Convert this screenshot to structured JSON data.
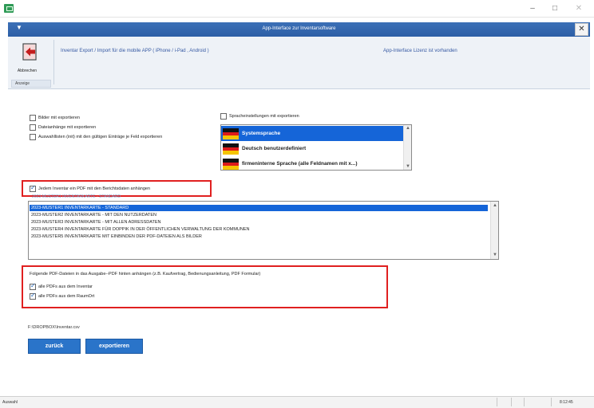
{
  "window": {
    "minimize": "–",
    "maximize": "□",
    "close": "✕"
  },
  "dialog": {
    "menu_icon": "▼",
    "title": "App-Interface zur Inventarsoftware",
    "close": "✕"
  },
  "ribbon": {
    "back_label": "Abbrechen",
    "group_label": "Anzeige",
    "caption": "Inventar Export / Import für die mobile APP ( iPhone / i-Pad , Android )",
    "license": "App-Interface Lizenz ist vorhanden"
  },
  "options": {
    "images": "Bilder mit exportieren",
    "attachments": "Dateianhänge mit exportieren",
    "selection_lists": "Auswahllisten (init) mit den gültigen Einträge je Feld exportieren",
    "language_settings": "Spracheinstellungen mit exportieren"
  },
  "languages": [
    {
      "label": "Systemsprache",
      "selected": true
    },
    {
      "label": "Deutsch benutzerdefiniert",
      "selected": false
    },
    {
      "label": "firmeninterne Sprache (alle Feldnamen mit x...)",
      "selected": false
    }
  ],
  "attach_pdf": {
    "label": "Jedem Inventar ein PDF mit den Berichtsdaten anhängen",
    "checked": true
  },
  "sub_link": "2023-MUSTER1 INVENTARKARTE - STANDARD",
  "reports": [
    {
      "label": "2023-MUSTER1 INVENTARKARTE - STANDARD",
      "selected": true
    },
    {
      "label": "2023-MUSTER2 INVENTARKARTE - MIT DEN NUTZERDATEN",
      "selected": false
    },
    {
      "label": "2023-MUSTER3 INVENTARKARTE - MIT ALLEN ADRESSDATEN",
      "selected": false
    },
    {
      "label": "2023-MUSTER4 INVENTARKARTE FÜR DOPPIK IN DER ÖFFENTLICHEN VERWALTUNG DER KOMMUNEN",
      "selected": false
    },
    {
      "label": "2023-MUSTER5 INVENTARKARTE MIT EINBINDEN DER PDF-DATEIEN ALS BILDER",
      "selected": false
    }
  ],
  "pdf_section": {
    "heading": "Folgende PDF-Dateien in das Ausgabe--PDF hinten anhängen (z.B. Kaufvertrag, Bedienungsanleitung, PDF Formular)",
    "inventory_pdfs": "alle PDFs aus dem Inventar",
    "room_pdfs": "alle PDFs aus dem RaumOrt"
  },
  "path": "F:\\DROPBOX\\Inventar.csv",
  "buttons": {
    "back": "zurück",
    "export": "exportieren"
  },
  "status": {
    "left": "Auswahl",
    "time": "8:12:45"
  },
  "colors": {
    "accent": "#2a74c9",
    "selection": "#1565d8",
    "highlight_box": "#e02020"
  }
}
